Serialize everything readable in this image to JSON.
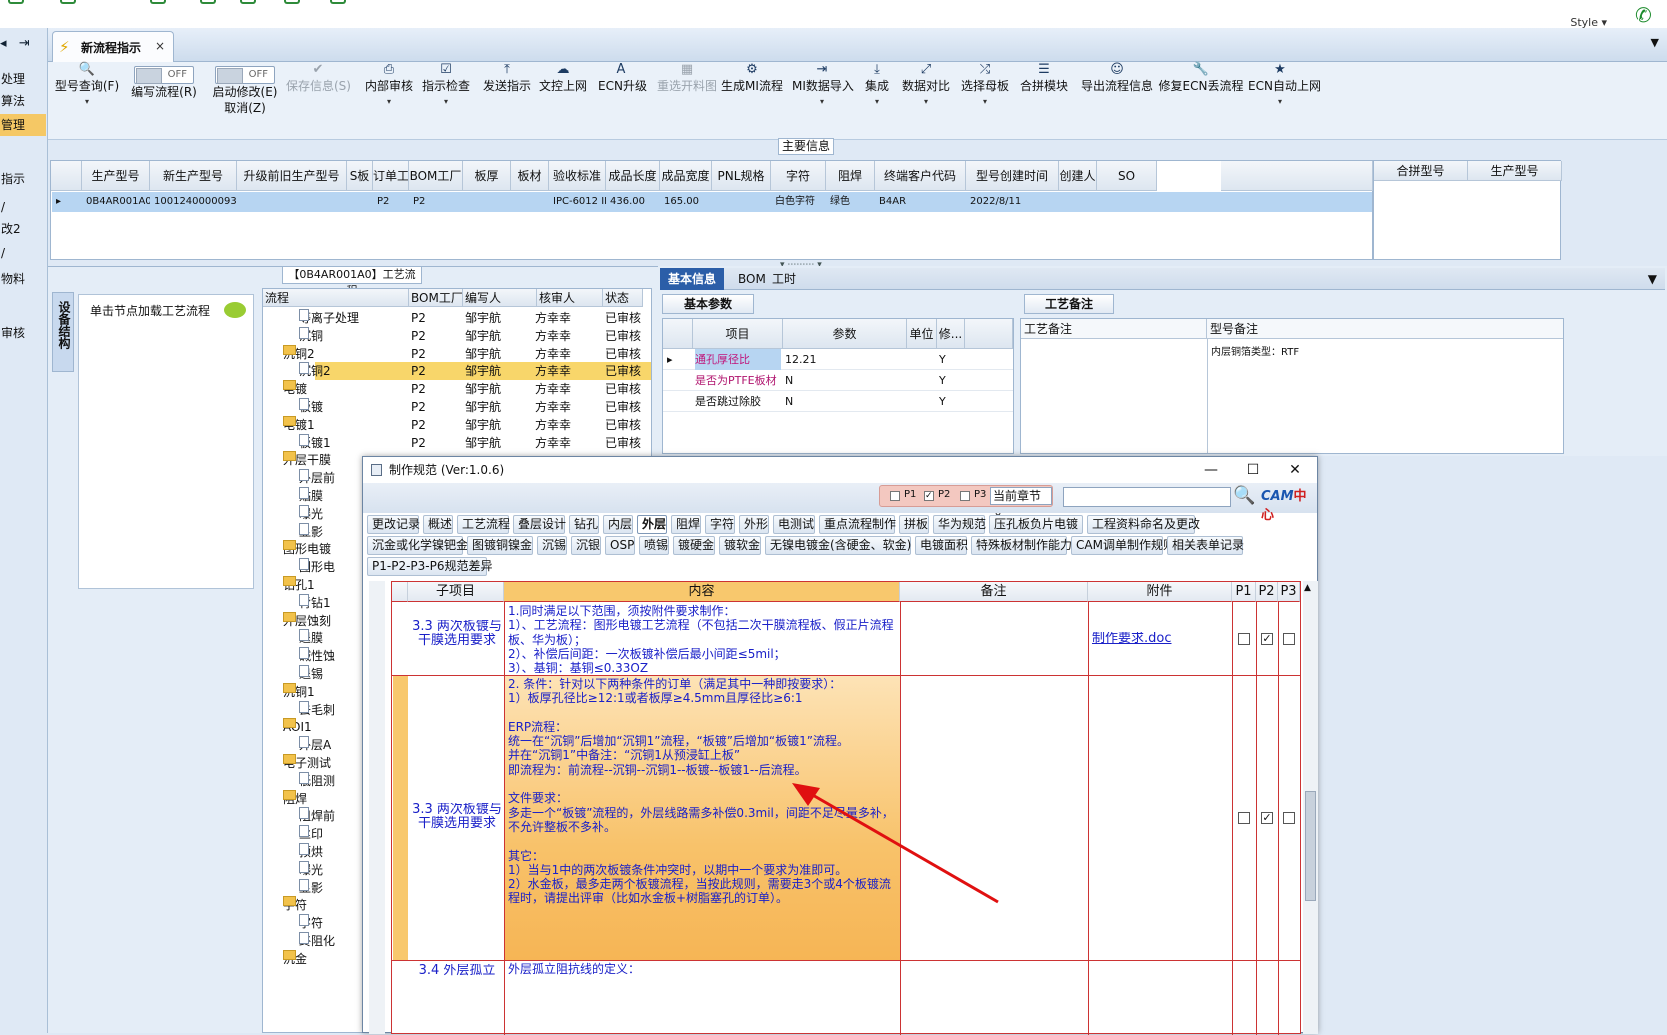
{
  "header": {
    "style_label": "Style ▾",
    "phone_icon": "phone-icon"
  },
  "left_nav": [
    "处理",
    "算法",
    "管理",
    "指示",
    "/",
    "改2",
    "/",
    "物料",
    "",
    "审核"
  ],
  "tab": {
    "title": "新流程指示",
    "close": "×"
  },
  "toolbar": [
    {
      "label": "型号查询(F)",
      "icon": "search-icon",
      "dd": "▾"
    },
    {
      "label": "编写流程(R)",
      "toggle": "OFF"
    },
    {
      "label": "启动修改(E)",
      "label2": "取消(Z)",
      "toggle": "OFF"
    },
    {
      "label": "保存信息(S)",
      "icon": "check-icon",
      "disabled": true
    },
    {
      "label": "内部审核",
      "icon": "print-icon",
      "dd": "▾"
    },
    {
      "label": "指示检查",
      "icon": "checklist-icon",
      "dd": "▾"
    },
    {
      "label": "发送指示",
      "icon": "upload-icon"
    },
    {
      "label": "文控上网",
      "icon": "cloud-upload-icon"
    },
    {
      "label": "ECN升级",
      "icon": "ecn-icon"
    },
    {
      "label": "重选开料图",
      "icon": "image-icon",
      "disabled": true
    },
    {
      "label": "生成MI流程",
      "icon": "gears-icon"
    },
    {
      "label": "MI数据导入",
      "icon": "import-icon",
      "dd": "▾"
    },
    {
      "label": "集成",
      "icon": "download-icon",
      "dd": "▾"
    },
    {
      "label": "数据对比",
      "icon": "compare-icon",
      "dd": "▾"
    },
    {
      "label": "选择母板",
      "icon": "shuffle-icon",
      "dd": "▾"
    },
    {
      "label": "合拼模块",
      "icon": "list-icon"
    },
    {
      "label": "导出流程信息",
      "icon": "smile-icon"
    },
    {
      "label": "修复ECN丢流程",
      "icon": "wrench-icon"
    },
    {
      "label": "ECN自动上网",
      "icon": "star-icon",
      "dd": "▾"
    }
  ],
  "main_info": {
    "label": "主要信息",
    "headers": [
      "生产型号",
      "新生产型号",
      "升级前旧生产型号",
      "S板",
      "订单工厂",
      "BOM工厂",
      "板厚",
      "板材",
      "验收标准",
      "成品长度",
      "成品宽度",
      "PNL规格",
      "字符",
      "阻焊",
      "终端客户代码",
      "型号创建时间",
      "创建人",
      "SO"
    ],
    "row": [
      "0B4AR001A0",
      "10012400000938",
      "",
      "",
      "P2",
      "P2",
      "",
      "",
      "IPC-6012 II级",
      "436.00",
      "165.00",
      "",
      "白色字符",
      "绿色",
      "B4AR",
      "2022/8/11",
      "",
      ""
    ],
    "right_headers": [
      "合拼型号",
      "生产型号"
    ]
  },
  "flow": {
    "title": "【0B4AR001A0】工艺流程",
    "vtab": "设备结构",
    "node_load": "单击节点加载工艺流程",
    "headers": [
      "流程",
      "BOM工厂",
      "编写人",
      "核审人",
      "状态"
    ],
    "rows": [
      {
        "name": "等离子处理",
        "lvl": 2,
        "f": "P2",
        "w": "邹宇航",
        "c": "方幸幸",
        "s": "已审核"
      },
      {
        "name": "沉铜",
        "lvl": 2,
        "f": "P2",
        "w": "邹宇航",
        "c": "方幸幸",
        "s": "已审核"
      },
      {
        "name": "沉铜2",
        "lvl": 1,
        "f": "P2",
        "w": "邹宇航",
        "c": "方幸幸",
        "s": "已审核"
      },
      {
        "name": "沉铜2",
        "lvl": 2,
        "f": "P2",
        "w": "邹宇航",
        "c": "方幸幸",
        "s": "已审核",
        "sel": true
      },
      {
        "name": "电镀",
        "lvl": 1,
        "f": "P2",
        "w": "邹宇航",
        "c": "方幸幸",
        "s": "已审核"
      },
      {
        "name": "板镀",
        "lvl": 2,
        "f": "P2",
        "w": "邹宇航",
        "c": "方幸幸",
        "s": "已审核"
      },
      {
        "name": "电镀1",
        "lvl": 1,
        "f": "P2",
        "w": "邹宇航",
        "c": "方幸幸",
        "s": "已审核"
      },
      {
        "name": "板镀1",
        "lvl": 2,
        "f": "P2",
        "w": "邹宇航",
        "c": "方幸幸",
        "s": "已审核"
      },
      {
        "name": "外层干膜",
        "lvl": 1
      },
      {
        "name": "外层前",
        "lvl": 2
      },
      {
        "name": "贴膜",
        "lvl": 2
      },
      {
        "name": "曝光",
        "lvl": 2
      },
      {
        "name": "显影",
        "lvl": 2
      },
      {
        "name": "图形电镀",
        "lvl": 1
      },
      {
        "name": "图形电",
        "lvl": 2
      },
      {
        "name": "钻孔1",
        "lvl": 1
      },
      {
        "name": "背钻1",
        "lvl": 2
      },
      {
        "name": "外层蚀刻",
        "lvl": 1
      },
      {
        "name": "退膜",
        "lvl": 2
      },
      {
        "name": "碱性蚀",
        "lvl": 2
      },
      {
        "name": "退锡",
        "lvl": 2
      },
      {
        "name": "沉铜1",
        "lvl": 1
      },
      {
        "name": "去毛刺",
        "lvl": 2
      },
      {
        "name": "AOI1",
        "lvl": 1
      },
      {
        "name": "外层A",
        "lvl": 2
      },
      {
        "name": "电子测试",
        "lvl": 1
      },
      {
        "name": "低阻测",
        "lvl": 2
      },
      {
        "name": "阻焊",
        "lvl": 1
      },
      {
        "name": "阻焊前",
        "lvl": 2
      },
      {
        "name": "丝印",
        "lvl": 2
      },
      {
        "name": "预烘",
        "lvl": 2
      },
      {
        "name": "曝光",
        "lvl": 2
      },
      {
        "name": "显影",
        "lvl": 2
      },
      {
        "name": "字符",
        "lvl": 1
      },
      {
        "name": "字符",
        "lvl": 2
      },
      {
        "name": "终阻化",
        "lvl": 2
      },
      {
        "name": "沉金",
        "lvl": 1
      }
    ]
  },
  "right_tabs": [
    "基本信息",
    "BOM",
    "工时"
  ],
  "basic": {
    "tab": "基本参数",
    "headers": [
      "项目",
      "参数",
      "单位",
      "修..."
    ],
    "rows": [
      {
        "item": "通孔厚径比",
        "val": "12.21",
        "mod": "Y"
      },
      {
        "item": "是否为PTFE板材",
        "val": "N",
        "mod": "Y"
      },
      {
        "item": "是否跳过除胶",
        "val": "N",
        "mod": "Y"
      }
    ]
  },
  "craft": {
    "tab": "工艺备注",
    "h1": "工艺备注",
    "h2": "型号备注",
    "note": "内层铜箔类型：RTF"
  },
  "dialog": {
    "title": "制作规范 (Ver:1.0.6)",
    "filter": {
      "p1": "P1",
      "p2": "P2",
      "p3": "P3",
      "chapter": "当前章节"
    },
    "logo_a": "CAM",
    "logo_b": "中心",
    "tabs1": [
      "更改记录",
      "概述",
      "工艺流程",
      "叠层设计",
      "钻孔",
      "内层",
      "外层",
      "阻焊",
      "字符",
      "外形",
      "电测试",
      "重点流程制作",
      "拼板",
      "华为规范",
      "压孔板负片电镀",
      "工程资料命名及更改"
    ],
    "tabs2": [
      "沉金或化学镍钯金",
      "图镀铜镍金",
      "沉锡",
      "沉银",
      "OSP",
      "喷锡",
      "镀硬金",
      "镀软金",
      "无镍电镀金(含硬金、软金)",
      "电镀面积",
      "特殊板材制作能力",
      "CAM调单制作规则",
      "相关表单记录"
    ],
    "tabs3": [
      "P1-P2-P3-P6规范差异"
    ],
    "headers": [
      "子项目",
      "内容",
      "备注",
      "附件",
      "P1",
      "P2",
      "P3"
    ],
    "rows": [
      {
        "sub": "3.3 两次板镀与干膜选用要求",
        "content": "1.同时满足以下范围，须按附件要求制作：\n1）、工艺流程：图形电镀工艺流程（不包括二次干膜流程板、假正片流程板、华为板）；\n2）、补偿后间距：一次板镀补偿后最小间距≤5mil；\n3）、基铜：基铜≤0.33OZ",
        "attach": "制作要求.doc",
        "p": [
          false,
          true,
          false
        ]
      },
      {
        "sub": "3.3 两次板镀与干膜选用要求",
        "content": "2. 条件：针对以下两种条件的订单（满足其中一种即按要求）：\n1）板厚孔径比≥12:1或者板厚≥4.5mm且厚径比≥6:1\n\nERP流程：\n统一在“沉铜”后增加“沉铜1”流程，“板镀”后增加“板镀1”流程。\n并在“沉铜1”中备注：“沉铜1从预浸缸上板”\n即流程为：前流程--沉铜--沉铜1--板镀--板镀1--后流程。\n\n文件要求：\n多走一个“板镀”流程的，外层线路需多补偿0.3mil，间距不足尽量多补，不允许整板不多补。\n\n其它：\n1）当与1中的两次板镀条件冲突时，以期中一个要求为准即可。\n2）水金板，最多走两个板镀流程，当按此规则，需要走3个或4个板镀流程时，请提出评审（比如水金板+树脂塞孔的订单）。",
        "attach": "",
        "p": [
          false,
          true,
          false
        ]
      },
      {
        "sub": "3.4 外层孤立",
        "content": "外层孤立阻抗线的定义：",
        "attach": "",
        "p": [
          false,
          false,
          false
        ]
      }
    ]
  }
}
